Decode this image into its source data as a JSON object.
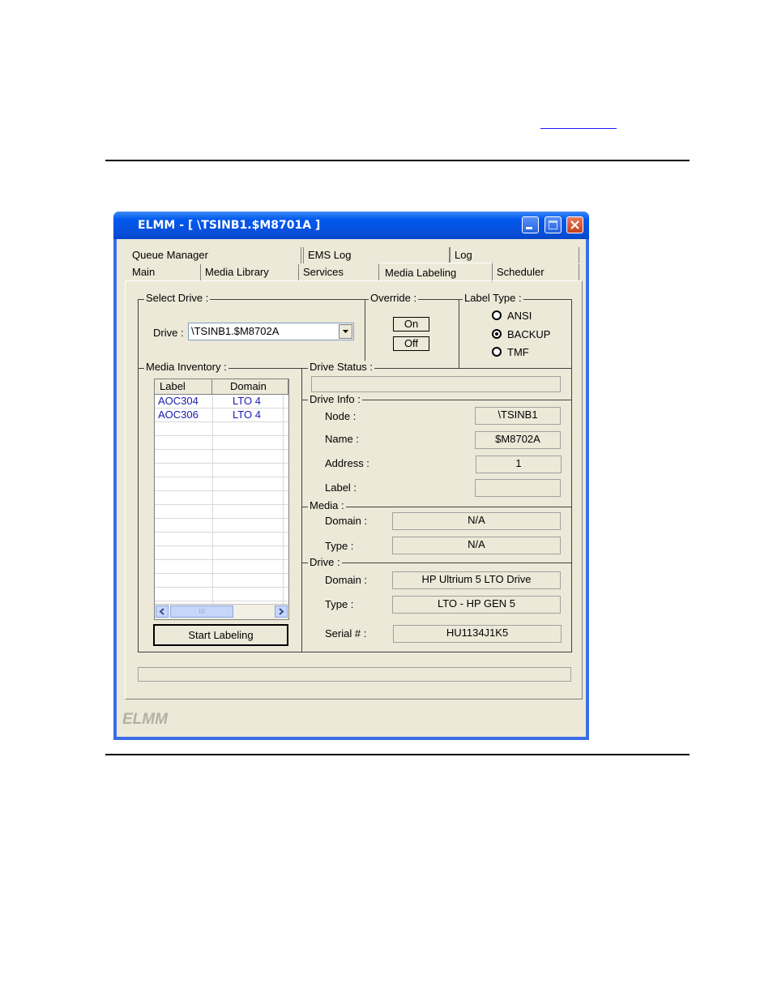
{
  "window": {
    "title": "ELMM - [ \\TSINB1.$M8701A ]",
    "footer_logo": "ELMM"
  },
  "tabs": {
    "row1": [
      "Queue Manager",
      "EMS Log",
      "Log"
    ],
    "row2": [
      "Main",
      "Media Library",
      "Services",
      "Media Labeling",
      "Scheduler"
    ],
    "active": "Media Labeling"
  },
  "select_drive": {
    "group_label": "Select Drive :",
    "drive_label": "Drive :",
    "drive_value": "\\TSINB1.$M8702A"
  },
  "override": {
    "group_label": "Override :",
    "on_label": "On",
    "off_label": "Off"
  },
  "label_type": {
    "group_label": "Label Type :",
    "options": [
      "ANSI",
      "BACKUP",
      "TMF"
    ],
    "selected": "BACKUP"
  },
  "media_inventory": {
    "group_label": "Media Inventory :",
    "columns": [
      "Label",
      "Domain"
    ],
    "rows": [
      [
        "AOC304",
        "LTO 4"
      ],
      [
        "AOC306",
        "LTO 4"
      ]
    ],
    "scroll_grip": "III",
    "start_button": "Start Labeling"
  },
  "drive_status": {
    "group_label": "Drive Status :",
    "value": ""
  },
  "drive_info": {
    "group_label": "Drive Info :",
    "node_label": "Node :",
    "node_value": "\\TSINB1",
    "name_label": "Name :",
    "name_value": "$M8702A",
    "address_label": "Address :",
    "address_value": "1",
    "label_label": "Label :",
    "label_value": ""
  },
  "media": {
    "group_label": "Media :",
    "domain_label": "Domain :",
    "domain_value": "N/A",
    "type_label": "Type :",
    "type_value": "N/A"
  },
  "drive": {
    "group_label": "Drive :",
    "domain_label": "Domain :",
    "domain_value": "HP Ultrium 5 LTO Drive",
    "type_label": "Type :",
    "type_value": "LTO - HP GEN 5",
    "serial_label": "Serial # :",
    "serial_value": "HU1134J1K5"
  },
  "colors": {
    "titlebar": "#0058ee",
    "face": "#ece9d8",
    "list_text": "#1a1ab0"
  }
}
